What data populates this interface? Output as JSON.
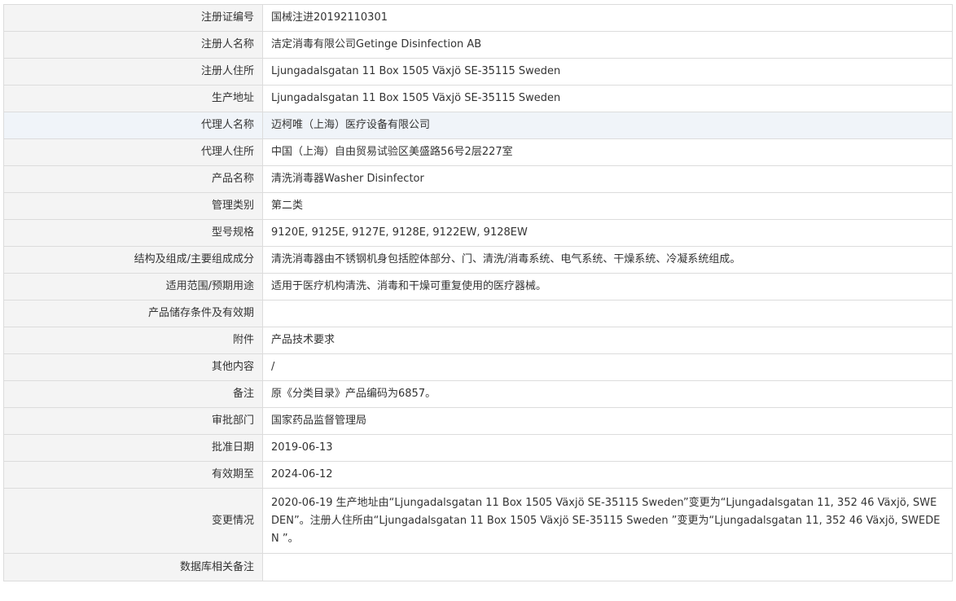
{
  "rows": [
    {
      "label": "注册证编号",
      "value": "国械注进20192110301"
    },
    {
      "label": "注册人名称",
      "value": "洁定消毒有限公司Getinge Disinfection AB"
    },
    {
      "label": "注册人住所",
      "value": "Ljungadalsgatan 11 Box 1505 Växjö SE-35115 Sweden"
    },
    {
      "label": "生产地址",
      "value": "Ljungadalsgatan 11 Box 1505 Växjö SE-35115 Sweden"
    },
    {
      "label": "代理人名称",
      "value": "迈柯唯（上海）医疗设备有限公司"
    },
    {
      "label": "代理人住所",
      "value": "中国（上海）自由贸易试验区美盛路56号2层227室"
    },
    {
      "label": "产品名称",
      "value": "清洗消毒器Washer Disinfector"
    },
    {
      "label": "管理类别",
      "value": "第二类"
    },
    {
      "label": "型号规格",
      "value": "9120E, 9125E, 9127E, 9128E, 9122EW, 9128EW"
    },
    {
      "label": "结构及组成/主要组成成分",
      "value": "清洗消毒器由不锈钢机身包括腔体部分、门、清洗/消毒系统、电气系统、干燥系统、冷凝系统组成。"
    },
    {
      "label": "适用范围/预期用途",
      "value": "适用于医疗机构清洗、消毒和干燥可重复使用的医疗器械。"
    },
    {
      "label": "产品储存条件及有效期",
      "value": ""
    },
    {
      "label": "附件",
      "value": "产品技术要求"
    },
    {
      "label": "其他内容",
      "value": "/"
    },
    {
      "label": "备注",
      "value": "原《分类目录》产品编码为6857。"
    },
    {
      "label": "审批部门",
      "value": "国家药品监督管理局"
    },
    {
      "label": "批准日期",
      "value": "2019-06-13"
    },
    {
      "label": "有效期至",
      "value": "2024-06-12"
    },
    {
      "label": "变更情况",
      "value": "2020-06-19 生产地址由“Ljungadalsgatan 11 Box 1505 Växjö SE-35115 Sweden”变更为“Ljungadalsgatan 11, 352 46 Växjö, SWEDEN”。注册人住所由“Ljungadalsgatan 11 Box 1505 Växjö SE-35115 Sweden ”变更为“Ljungadalsgatan 11, 352 46 Växjö, SWEDEN ”。"
    },
    {
      "label": "数据库相关备注",
      "value": ""
    }
  ]
}
